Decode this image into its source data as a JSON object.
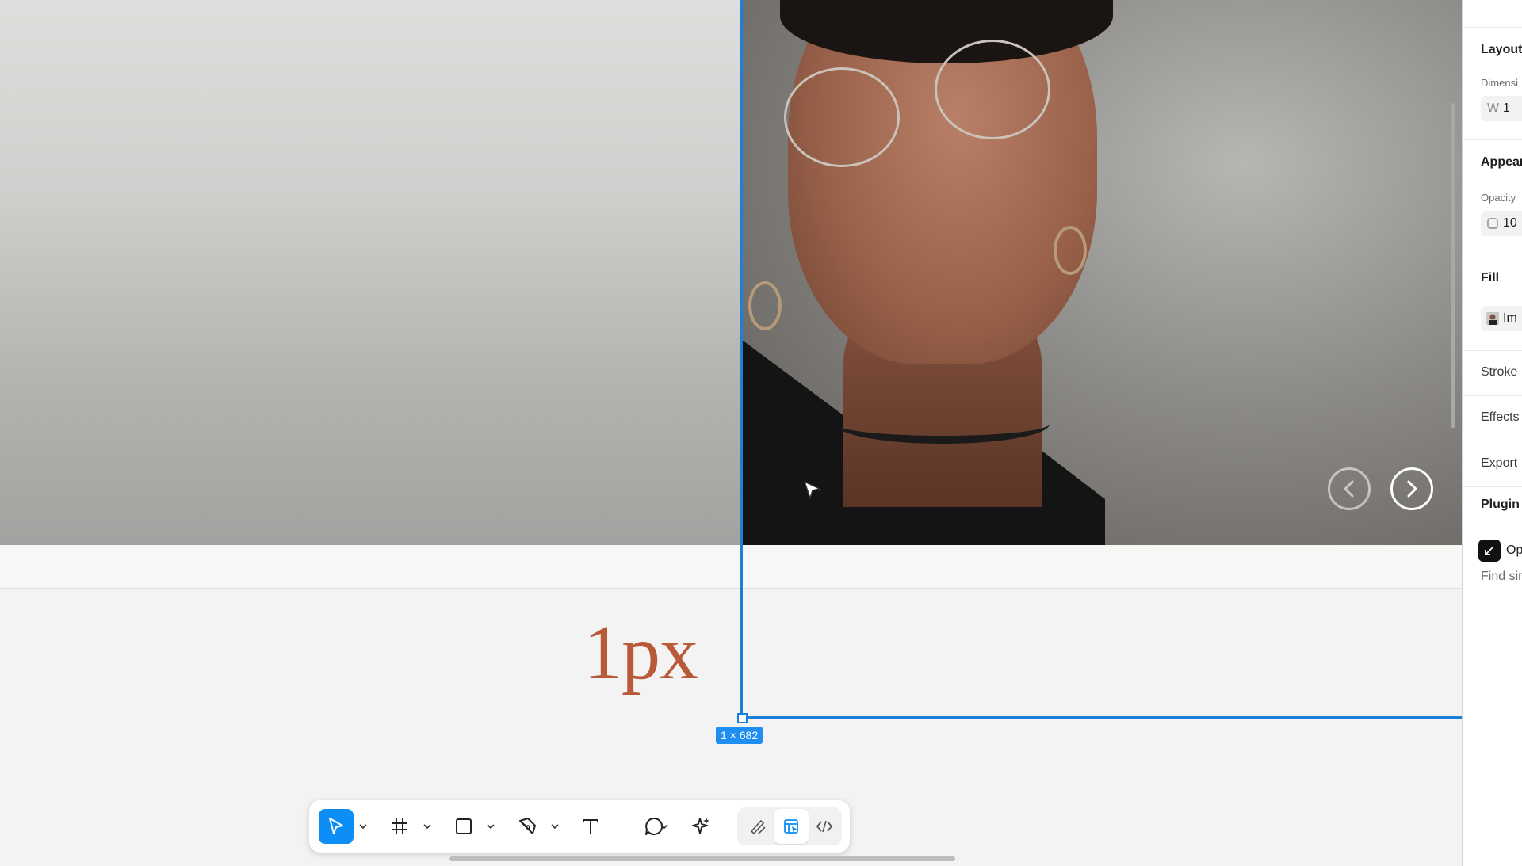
{
  "canvas": {
    "measure_label": "1px",
    "dimension_badge": "1 × 682",
    "carousel": {
      "prev_icon": "chevron-left-icon",
      "next_icon": "chevron-right-icon"
    }
  },
  "toolbar": {
    "tools": [
      "move-tool",
      "frame-tool",
      "shape-tool",
      "pen-tool",
      "text-tool",
      "comment-tool",
      "ai-tool"
    ],
    "modes": [
      "draw-mode",
      "design-mode",
      "dev-mode"
    ],
    "active_tool": "move-tool",
    "active_mode": "design-mode",
    "accent_color": "#0d8ef7"
  },
  "right_panel": {
    "layout_heading": "Layout",
    "dimensions_label": "Dimensi",
    "width_prefix": "W",
    "width_value": "1",
    "appearance_heading": "Appear",
    "opacity_label": "Opacity",
    "opacity_value": "10",
    "fill_heading": "Fill",
    "fill_value": "Im",
    "stroke_heading": "Stroke",
    "effects_heading": "Effects",
    "export_heading": "Export",
    "plugin_heading": "Plugin",
    "plugin_name": "Op",
    "plugin_sub": "Find sir"
  },
  "colors": {
    "selection": "#1e7fdb",
    "badge": "#1e8ef0",
    "measure_text": "#b85a38"
  }
}
